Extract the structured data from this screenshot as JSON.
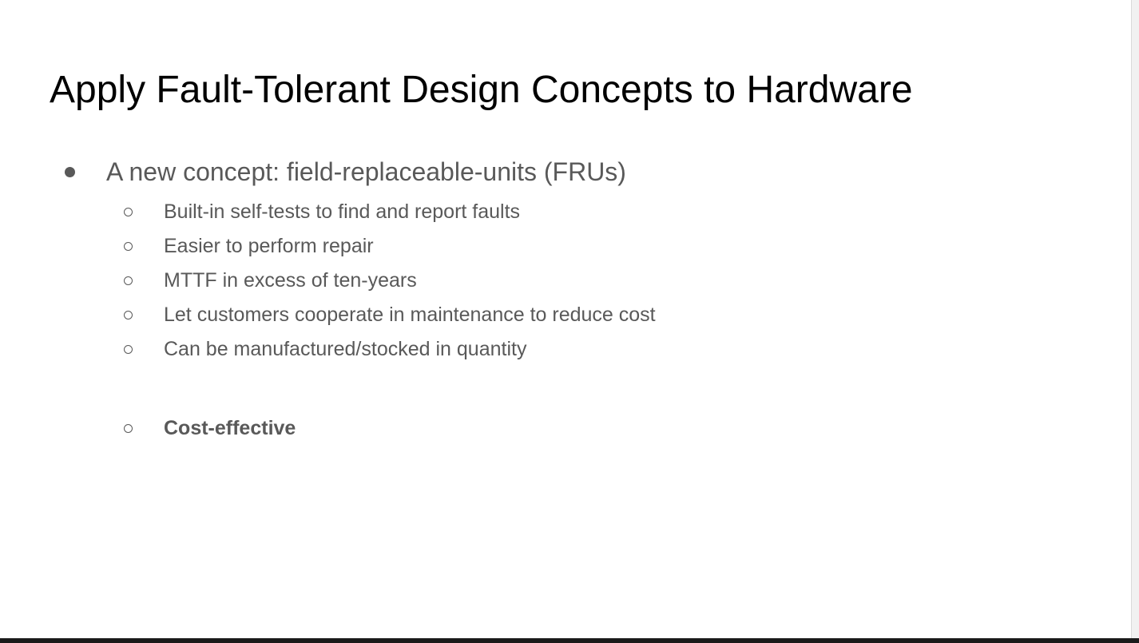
{
  "slide": {
    "title": "Apply Fault-Tolerant Design Concepts to Hardware",
    "bullet": "A new concept: field-replaceable-units (FRUs)",
    "sub_items": [
      "Built-in self-tests to find and report faults",
      "Easier to perform repair",
      "MTTF in excess of ten-years",
      "Let customers cooperate in maintenance to reduce cost",
      "Can be manufactured/stocked in quantity",
      "Cost-effective"
    ]
  },
  "colors": {
    "title": "#000000",
    "body_text": "#595959",
    "background": "#ffffff"
  }
}
